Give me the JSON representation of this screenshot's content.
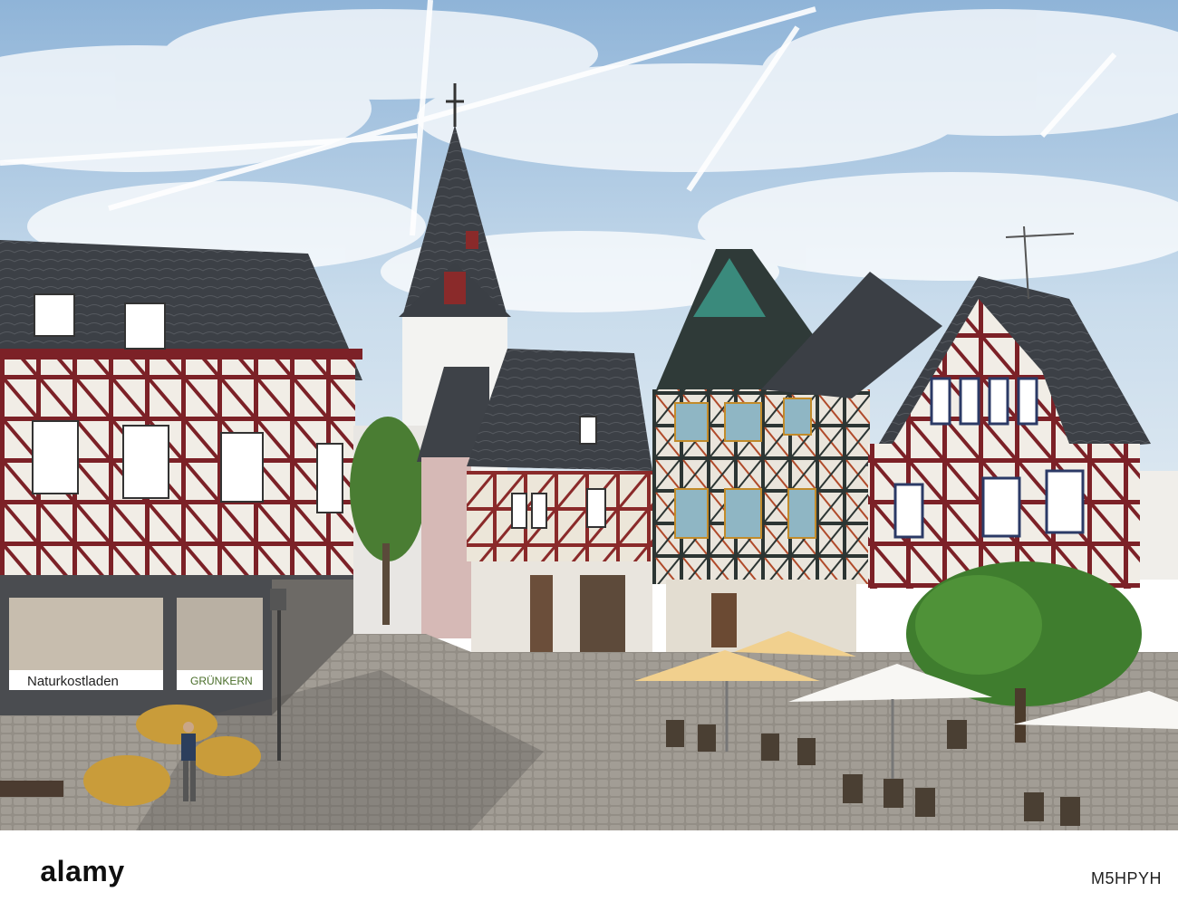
{
  "photo": {
    "subject": "half-timbered old town square with church steeple",
    "shop_signs": {
      "naturkost": "Naturkostladen",
      "gruenkern": "GRÜNKERN"
    }
  },
  "footer": {
    "logo_text": "alamy",
    "image_id": "M5HPYH"
  },
  "colors": {
    "sky": "#cfe0ef",
    "timber_red": "#7e1f24",
    "plaster": "#f2efe8",
    "slate_roof": "#3f4348",
    "cobblestone": "#8f8a83",
    "umbrella_yellow": "#f1d08e",
    "tree_green": "#3f7d2e"
  }
}
